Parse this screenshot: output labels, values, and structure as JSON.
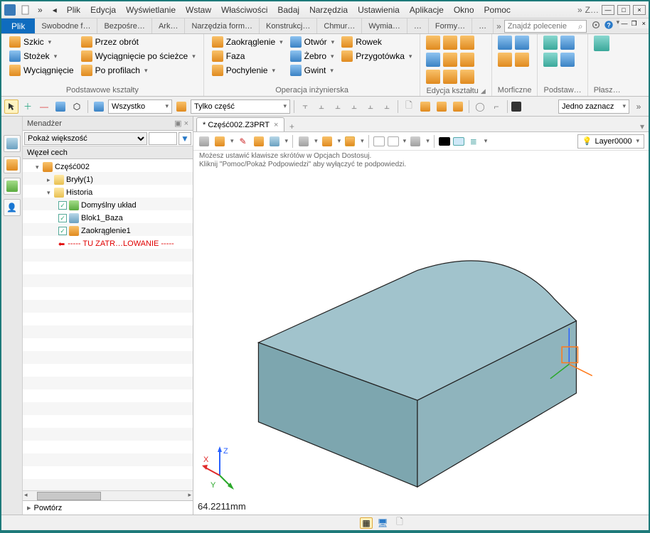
{
  "menu": {
    "items": [
      "Plik",
      "Edycja",
      "Wyświetlanie",
      "Wstaw",
      "Właściwości",
      "Badaj",
      "Narzędzia",
      "Ustawienia",
      "Aplikacje",
      "Okno",
      "Pomoc"
    ],
    "overflow_left": "»",
    "title_overflow": "»",
    "title_short": "Z…",
    "minimize": "—",
    "maximize": "□",
    "close": "×"
  },
  "tabs": {
    "file": "Plik",
    "contexts": [
      "Swobodne f…",
      "Bezpośre…",
      "Ark…",
      "Narzędzia form…",
      "Konstrukcj…",
      "Chmur…",
      "Wymia…",
      "…",
      "Formy…",
      "…"
    ],
    "overflow": "»"
  },
  "search": {
    "placeholder": "Znajdź polecenie"
  },
  "ribbon": {
    "group1": {
      "label": "Podstawowe kształty",
      "c1": [
        {
          "t": "Szkic"
        },
        {
          "t": "Stożek"
        },
        {
          "t": "Wyciągnięcie"
        }
      ],
      "c2": [
        {
          "t": "Przez obrót"
        },
        {
          "t": "Wyciągnięcie po ścieżce"
        },
        {
          "t": "Po profilach"
        }
      ]
    },
    "group2": {
      "label": "Operacja inżynierska",
      "c1": [
        {
          "t": "Zaokrąglenie"
        },
        {
          "t": "Faza"
        },
        {
          "t": "Pochylenie"
        }
      ],
      "c2": [
        {
          "t": "Otwór"
        },
        {
          "t": "Żebro"
        },
        {
          "t": "Gwint"
        }
      ],
      "c3": [
        {
          "t": "Rowek"
        },
        {
          "t": "Przygotówka"
        }
      ]
    },
    "group3": {
      "label": "Edycja kształtu"
    },
    "group4": {
      "label": "Morficzne"
    },
    "group5": {
      "label": "Podstaw…"
    },
    "group6": {
      "label": "Płasz…"
    }
  },
  "qtoolbar": {
    "select1": "Wszystko",
    "select2": "Tylko część",
    "select3": "Jedno zaznacz"
  },
  "manager": {
    "title": "Menadżer",
    "filter_select": "Pokaż większość",
    "subhead": "Węzeł cech",
    "tree": {
      "root": "Część002",
      "solids": "Bryły(1)",
      "history": "Historia",
      "items": [
        {
          "label": "Domyślny układ"
        },
        {
          "label": "Blok1_Baza"
        },
        {
          "label": "Zaokrąglenie1"
        }
      ],
      "rollback": "----- TU ZATR…LOWANIE -----"
    },
    "footer": "Powtórz"
  },
  "document": {
    "tab_prefix": "* ",
    "tab_name": "Część002.Z3PRT",
    "hints": {
      "l1": "Możesz ustawić klawisze skrótów w Opcjach Dostosuj.",
      "l2": "Kliknij \"Pomoc/Pokaż Podpowiedzi\" aby wyłączyć te podpowiedzi."
    },
    "triad": {
      "x": "X",
      "y": "Y",
      "z": "Z"
    },
    "measure": "64.2211mm",
    "layer": "Layer0000"
  },
  "mdi": {
    "minimize": "—",
    "restore": "❐",
    "close": "×"
  }
}
